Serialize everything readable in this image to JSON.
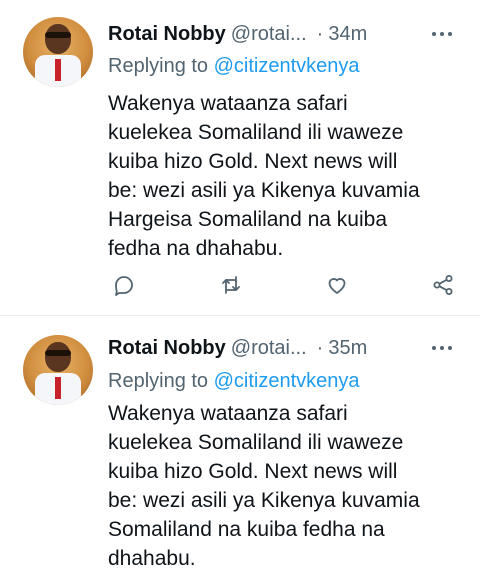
{
  "tweets": [
    {
      "author_name": "Rotai Nobby",
      "author_handle": "@rotai...",
      "separator": "·",
      "time": "34m",
      "replying_prefix": "Replying to",
      "replying_to": "@citizentvkenya",
      "lines": [
        "Wakenya wataanza safari",
        "kuelekea Somaliland ili waweze",
        "kuiba hizo Gold. Next news will",
        "be: wezi asili ya Kikenya kuvamia",
        "Hargeisa Somaliland na kuiba",
        "fedha na dhahabu."
      ],
      "icons": [
        "reply-icon",
        "retweet-icon",
        "like-icon",
        "share-icon"
      ]
    },
    {
      "author_name": "Rotai Nobby",
      "author_handle": "@rotai...",
      "separator": "·",
      "time": "35m",
      "replying_prefix": "Replying to",
      "replying_to": "@citizentvkenya",
      "lines": [
        "Wakenya wataanza safari",
        "kuelekea Somaliland ili waweze",
        "kuiba hizo Gold. Next news will",
        "be: wezi asili ya Kikenya kuvamia",
        "Somaliland na kuiba fedha na",
        "dhahabu."
      ]
    }
  ],
  "colors": {
    "text": "#0f1419",
    "secondary": "#536471",
    "link": "#1d9bf0",
    "divider": "#e6ecf0"
  }
}
